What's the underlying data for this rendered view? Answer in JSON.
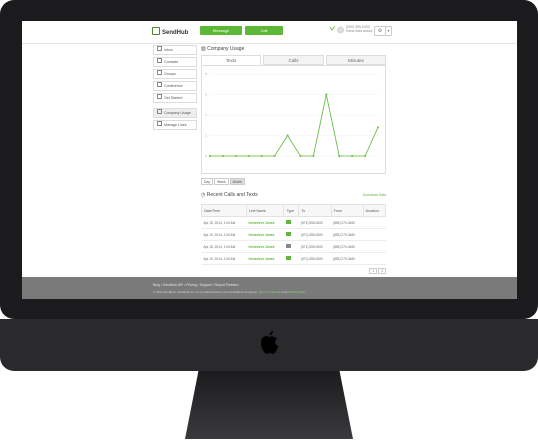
{
  "app": {
    "logo_text": "SendHub",
    "message_button": "Message",
    "call_button": "Call",
    "user_line1": "(000) 555-0000",
    "user_line2": "Gene Acts Assoc",
    "gear_button": "⚙"
  },
  "sidebar": {
    "items": [
      {
        "label": "Inbox",
        "icon": "inbox-icon"
      },
      {
        "label": "Contacts",
        "icon": "contacts-icon"
      },
      {
        "label": "Groups",
        "icon": "groups-icon"
      },
      {
        "label": "Conference",
        "icon": "conference-icon"
      },
      {
        "label": "Get Started",
        "icon": "star-icon"
      },
      {
        "label": "Company Usage",
        "icon": "chart-icon"
      },
      {
        "label": "Manage Lines",
        "icon": "lines-icon"
      }
    ]
  },
  "main": {
    "title": "Company Usage",
    "tabs": [
      "Texts",
      "Calls",
      "Minutes"
    ],
    "range_buttons": [
      "Day",
      "Week",
      "Month"
    ],
    "recent_title": "Recent Calls and Texts",
    "download_link": "Download Data",
    "table": {
      "headers": [
        "Date/Time",
        "Line Name",
        "Type",
        "To",
        "From",
        "Duration"
      ],
      "rows": [
        [
          "Apr 15, 2014, 1:00 AM",
          "Genevieve Jones",
          "(571) 555-0000",
          "(855) 270-0460"
        ],
        [
          "Apr 15, 2014, 1:00 AM",
          "Genevieve Jones",
          "(571) 555-0000",
          "(855) 270-0460"
        ],
        [
          "Apr 15, 2014, 1:00 AM",
          "Genevieve Jones",
          "(571) 555-0000",
          "(855) 270-0460"
        ],
        [
          "Apr 15, 2014, 1:00 AM",
          "Genevieve Jones",
          "(571) 555-0000",
          "(855) 270-0460"
        ]
      ]
    },
    "pager": [
      "1",
      "2"
    ]
  },
  "footer": {
    "line1": "Blog • SendHub API • Pricing • Support • Report Problem",
    "line2_prefix": "© 2014 Sendhub. SendHub Inc. is a small business communications company. ",
    "line2_link1": "Terms of Service",
    "line2_mid": " and ",
    "line2_link2": "Privacy Policy"
  },
  "chart_data": {
    "type": "line",
    "title": "",
    "xlabel": "",
    "ylabel": "",
    "x": [
      1,
      2,
      3,
      4,
      5,
      6,
      7,
      8,
      9,
      10,
      11,
      12,
      13
    ],
    "series": [
      {
        "values": [
          0,
          0,
          0,
          0,
          0,
          0,
          2,
          0,
          0,
          6,
          0,
          0,
          0,
          2.8
        ]
      }
    ],
    "y_ticks": [
      "0",
      "2",
      "4",
      "6",
      "8"
    ],
    "ylim": [
      0,
      8
    ],
    "grid": true,
    "colors": {
      "line": "#5cb836",
      "point": "#7dc455"
    }
  }
}
